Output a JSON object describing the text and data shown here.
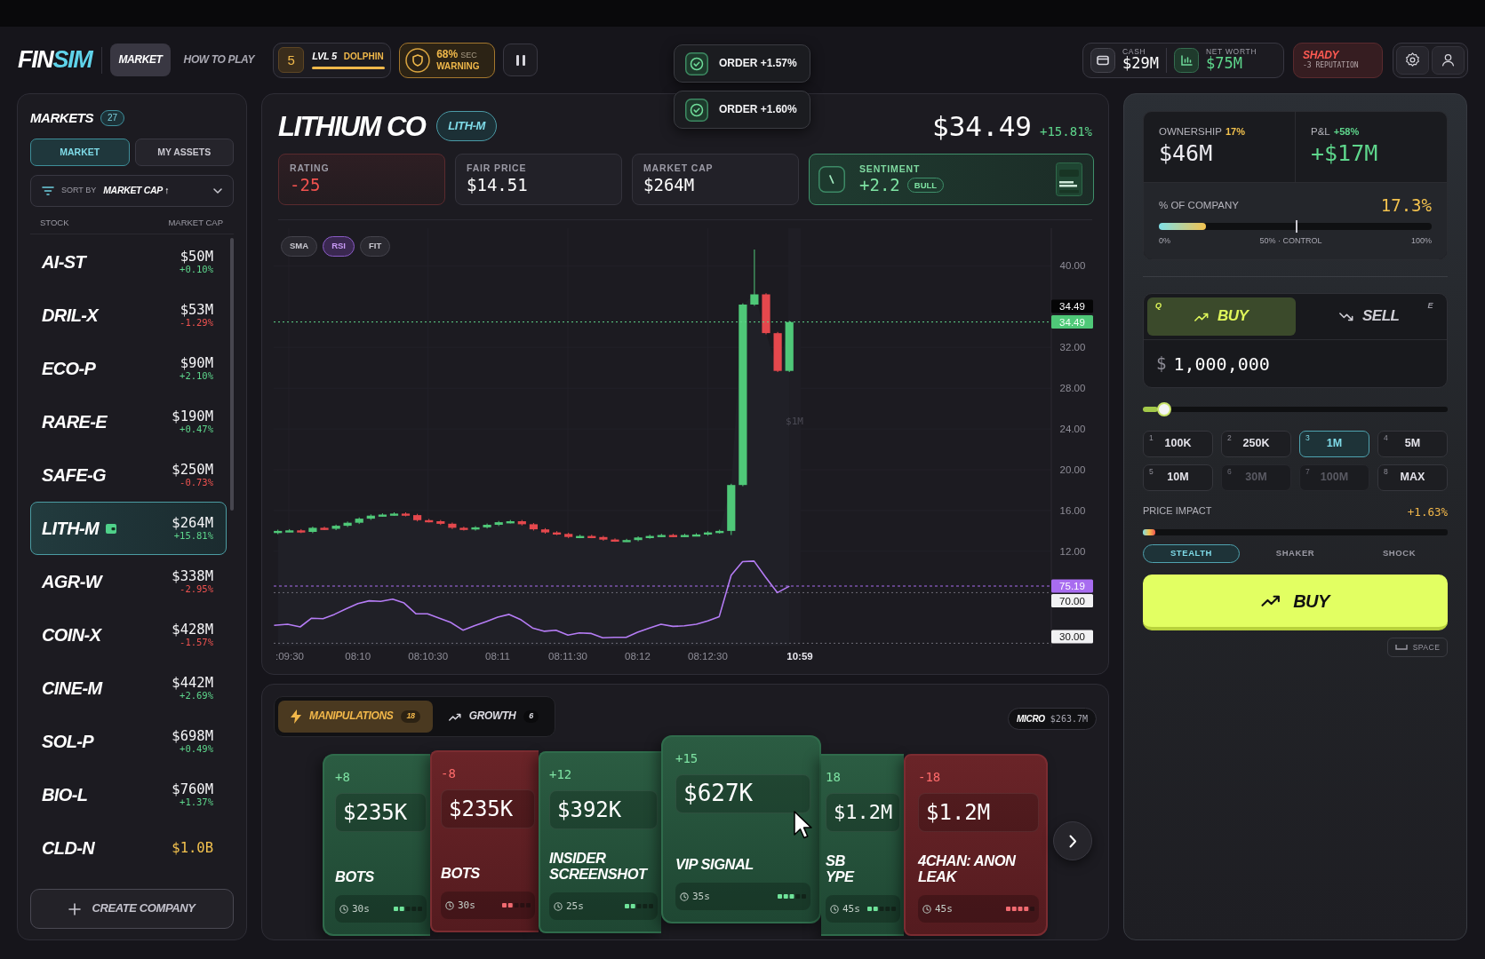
{
  "header": {
    "logo": {
      "lead": "FIN",
      "accent": "SIM"
    },
    "nav": [
      {
        "label": "MARKET",
        "selected": true
      },
      {
        "label": "HOW TO PLAY",
        "selected": false
      }
    ],
    "level": {
      "number": "5",
      "label": "LVL 5",
      "rank": "DOLPHIN"
    },
    "security": {
      "percent": "68%",
      "unit": "SEC",
      "status": "WARNING"
    },
    "wealth": [
      {
        "label": "CASH",
        "value": "$29M",
        "kind": "cash"
      },
      {
        "label": "NET WORTH",
        "value": "$75M",
        "kind": "net"
      }
    ],
    "reputation": {
      "title": "SHADY",
      "detail": "-3 REPUTATION"
    }
  },
  "toasts": [
    {
      "text": "ORDER +1.57%"
    },
    {
      "text": "ORDER +1.60%"
    }
  ],
  "markets": {
    "title": "MARKETS",
    "count": "27",
    "tabs": [
      {
        "label": "MARKET",
        "selected": true
      },
      {
        "label": "MY ASSETS",
        "selected": false
      }
    ],
    "sort": {
      "label": "SORT BY",
      "value": "MARKET CAP ↑"
    },
    "columns": [
      "STOCK",
      "MARKET CAP"
    ],
    "rows": [
      {
        "symbol": "AI-ST",
        "value": "$50M",
        "change": "+0.10%",
        "rising": true,
        "selected": false,
        "owned": false,
        "highlight": false
      },
      {
        "symbol": "DRIL-X",
        "value": "$53M",
        "change": "-1.29%",
        "rising": false,
        "selected": false,
        "owned": false,
        "highlight": false
      },
      {
        "symbol": "ECO-P",
        "value": "$90M",
        "change": "+2.10%",
        "rising": true,
        "selected": false,
        "owned": false,
        "highlight": false
      },
      {
        "symbol": "RARE-E",
        "value": "$190M",
        "change": "+0.47%",
        "rising": true,
        "selected": false,
        "owned": false,
        "highlight": false
      },
      {
        "symbol": "SAFE-G",
        "value": "$250M",
        "change": "-0.73%",
        "rising": false,
        "selected": false,
        "owned": false,
        "highlight": false
      },
      {
        "symbol": "LITH-M",
        "value": "$264M",
        "change": "+15.81%",
        "rising": true,
        "selected": true,
        "owned": true,
        "highlight": false
      },
      {
        "symbol": "AGR-W",
        "value": "$338M",
        "change": "-2.95%",
        "rising": false,
        "selected": false,
        "owned": false,
        "highlight": false
      },
      {
        "symbol": "COIN-X",
        "value": "$428M",
        "change": "-1.57%",
        "rising": false,
        "selected": false,
        "owned": false,
        "highlight": false
      },
      {
        "symbol": "CINE-M",
        "value": "$442M",
        "change": "+2.69%",
        "rising": true,
        "selected": false,
        "owned": false,
        "highlight": false
      },
      {
        "symbol": "SOL-P",
        "value": "$698M",
        "change": "+0.49%",
        "rising": true,
        "selected": false,
        "owned": false,
        "highlight": false
      },
      {
        "symbol": "BIO-L",
        "value": "$760M",
        "change": "+1.37%",
        "rising": true,
        "selected": false,
        "owned": false,
        "highlight": false
      },
      {
        "symbol": "CLD-N",
        "value": "$1.0B",
        "selected": false,
        "owned": false,
        "highlight": true
      }
    ],
    "create_button": "CREATE COMPANY"
  },
  "stock": {
    "name": "LITHIUM CO",
    "ticker": "LITH-M",
    "price": "$34.49",
    "change": "+15.81%",
    "stats": [
      {
        "label": "RATING",
        "value": "-25",
        "kind": "alert"
      },
      {
        "label": "FAIR PRICE",
        "value": "$14.51",
        "kind": "plain"
      },
      {
        "label": "MARKET CAP",
        "value": "$264M",
        "kind": "plain"
      },
      {
        "label": "SENTIMENT",
        "value": "+2.2",
        "badge": "BULL",
        "kind": "sentiment"
      }
    ]
  },
  "chart": {
    "toggles": [
      {
        "label": "SMA",
        "selected": false
      },
      {
        "label": "RSI",
        "selected": true
      },
      {
        "label": "FIT",
        "selected": false
      }
    ],
    "y_labels": [
      "40.00",
      "32.00",
      "28.00",
      "24.00",
      "20.00",
      "16.00",
      "12.00"
    ],
    "price_tags": [
      {
        "text": "34.49",
        "kind": "last"
      },
      {
        "text": "34.49",
        "kind": "price"
      }
    ],
    "rsi_tags": [
      {
        "text": "75.19",
        "kind": "rsi"
      },
      {
        "text": "70.00",
        "kind": "band"
      },
      {
        "text": "30.00",
        "kind": "band"
      }
    ],
    "x_labels": [
      ":09:30",
      "08:10",
      "08:10:30",
      "08:11",
      "08:11:30",
      "08:12",
      "08:12:30"
    ],
    "now_label": "10:59",
    "order_note": "$1M"
  },
  "position": {
    "ownership_label": "OWNERSHIP",
    "ownership_percent": "17%",
    "ownership_value": "$46M",
    "pnl_label": "P&L",
    "pnl_percent": "+58%",
    "pnl_value": "+$17M",
    "share_label": "% OF COMPANY",
    "share_value": "17.3%",
    "level": 0.173,
    "scale": [
      "0%",
      "50% · CONTROL",
      "100%"
    ]
  },
  "trade": {
    "sides": [
      {
        "label": "BUY",
        "hotkey": "Q",
        "selected": true,
        "kind": "buy"
      },
      {
        "label": "SELL",
        "hotkey": "E",
        "selected": false,
        "kind": "sell"
      }
    ],
    "currency": "$",
    "amount": "1,000,000",
    "slider": {
      "level": 0.05
    },
    "presets": [
      {
        "hotkey": "1",
        "label": "100K",
        "selected": false,
        "disabled": false
      },
      {
        "hotkey": "2",
        "label": "250K",
        "selected": false,
        "disabled": false
      },
      {
        "hotkey": "3",
        "label": "1M",
        "selected": true,
        "disabled": false
      },
      {
        "hotkey": "4",
        "label": "5M",
        "selected": false,
        "disabled": false
      },
      {
        "hotkey": "5",
        "label": "10M",
        "selected": false,
        "disabled": false
      },
      {
        "hotkey": "6",
        "label": "30M",
        "selected": false,
        "disabled": true
      },
      {
        "hotkey": "7",
        "label": "100M",
        "selected": false,
        "disabled": true
      },
      {
        "hotkey": "8",
        "label": "MAX",
        "selected": false,
        "disabled": false
      }
    ],
    "impact": {
      "label": "PRICE IMPACT",
      "value": "+1.63%",
      "level": 0.04
    },
    "modes": [
      {
        "label": "STEALTH",
        "selected": true
      },
      {
        "label": "SHAKER",
        "selected": false
      },
      {
        "label": "SHOCK",
        "selected": false
      }
    ],
    "submit": "BUY",
    "shortcut": "SPACE"
  },
  "actions": {
    "tabs": [
      {
        "label": "MANIPULATIONS",
        "count": "18",
        "selected": true,
        "kind": "bolt"
      },
      {
        "label": "GROWTH",
        "count": "6",
        "selected": false,
        "kind": "trend"
      }
    ],
    "tier": {
      "label": "MICRO",
      "value": "$263.7M"
    },
    "cards": [
      {
        "score": "+8",
        "value": "$235K",
        "title": "BOTS",
        "time": "30s",
        "kind": "bullish",
        "level": 0.4
      },
      {
        "score": "-8",
        "value": "$235K",
        "title": "BOTS",
        "time": "30s",
        "kind": "bearish",
        "level": 0.4
      },
      {
        "score": "+12",
        "value": "$392K",
        "title": "INSIDER SCREENSHOT",
        "time": "25s",
        "kind": "bullish",
        "level": 0.4
      },
      {
        "score": "+15",
        "value": "$627K",
        "title": "VIP SIGNAL",
        "time": "35s",
        "kind": "bullish",
        "level": 0.6
      },
      {
        "score": "18",
        "value": "$1.2M",
        "title": "SB YPE",
        "time": "45s",
        "kind": "bullish",
        "level": 0.4
      },
      {
        "score": "-18",
        "value": "$1.2M",
        "title": "4CHAN: ANON LEAK",
        "time": "45s",
        "kind": "bearish",
        "level": 0.8
      }
    ]
  }
}
